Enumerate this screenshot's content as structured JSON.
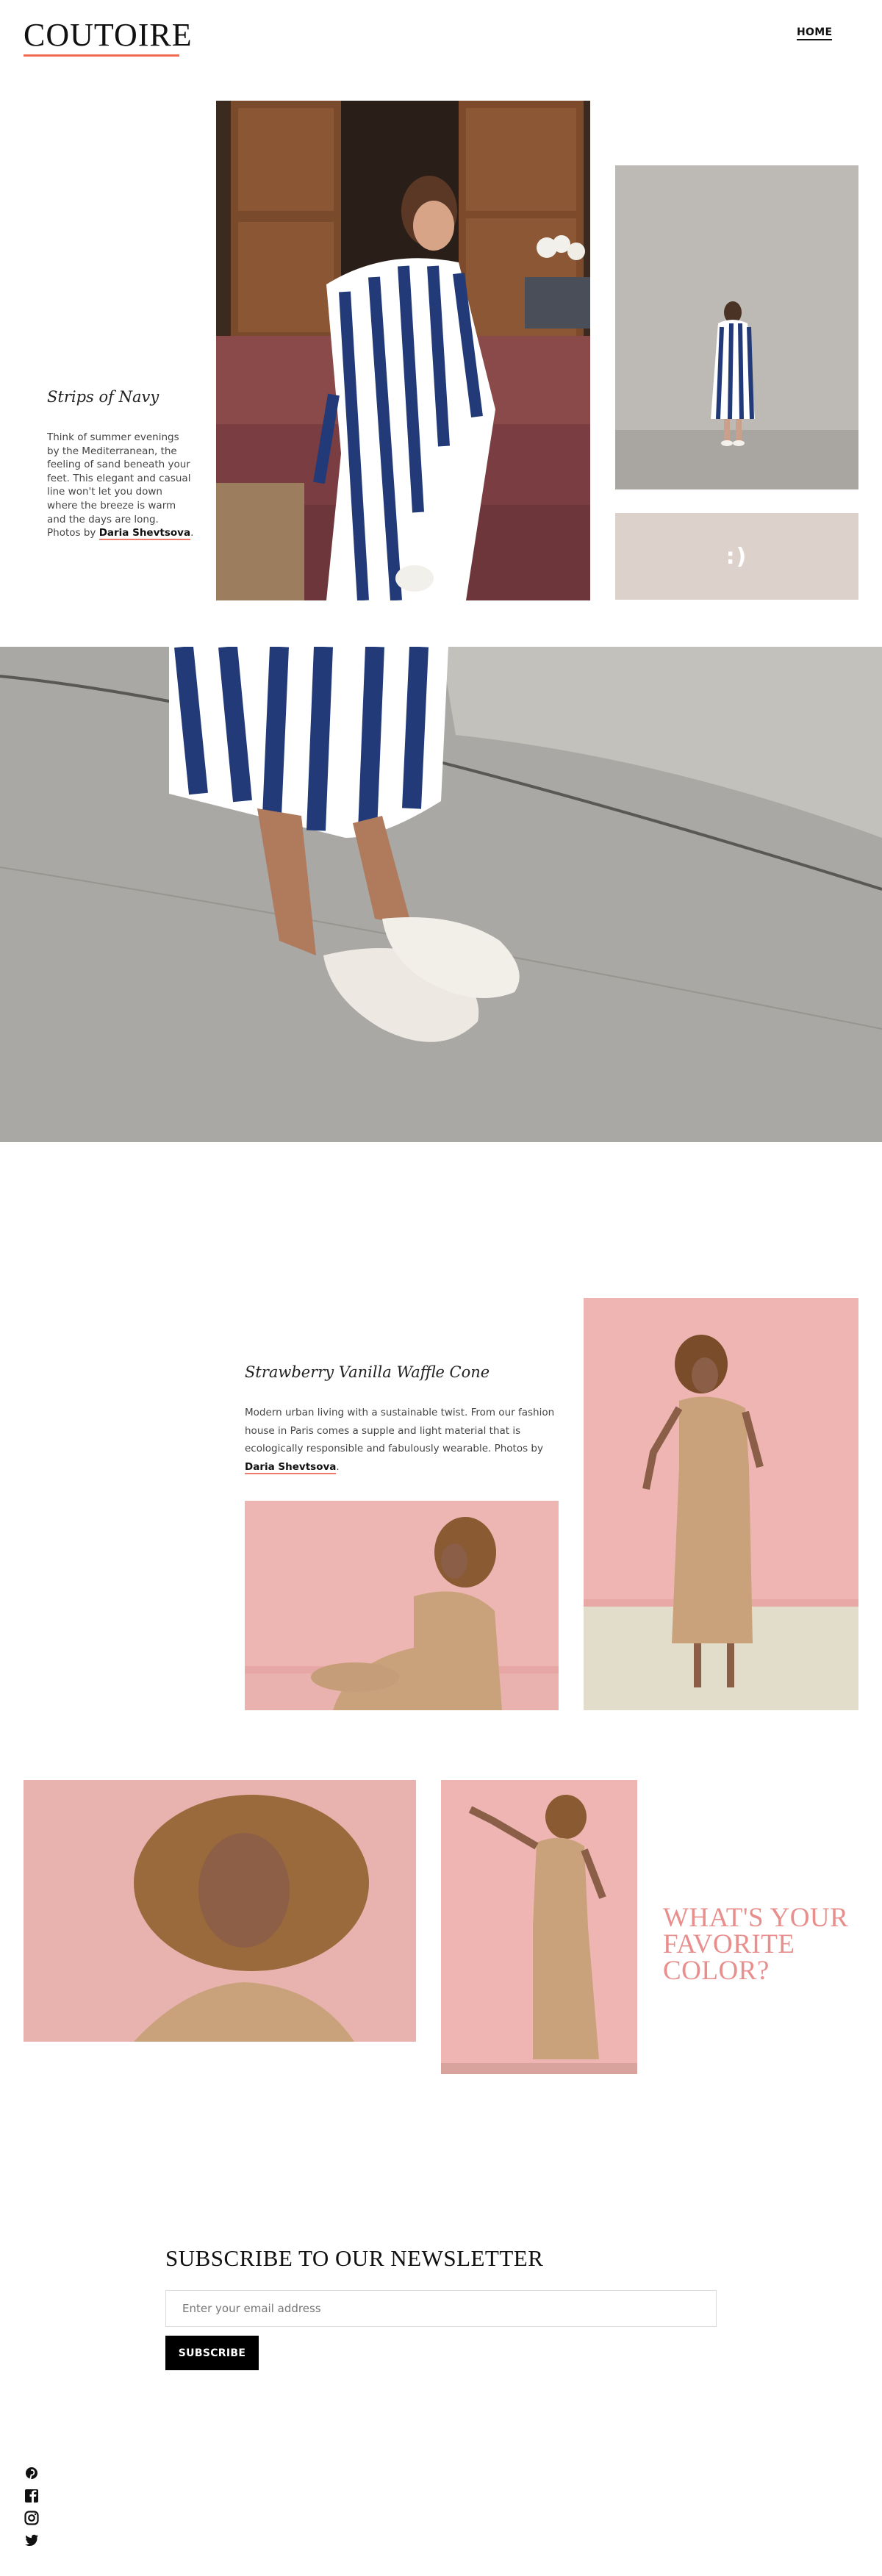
{
  "header": {
    "logo": "COUTOIRE",
    "nav": {
      "home": "HOME"
    }
  },
  "section1": {
    "title": "Strips of Navy",
    "text": "Think of summer evenings by the Mediterranean, the feeling of sand beneath your feet. This elegant and casual line won't let you down where the breeze is warm and the days are long. Photos by ",
    "credit": "Daria Shevtsova",
    "end": ".",
    "smile": ":)"
  },
  "section2": {
    "title": "Strawberry Vanilla Waffle Cone",
    "text": "Modern urban living with a sustainable twist. From our fashion house in Paris comes a supple and light material that is ecologically responsible and fabulously wearable. Photos by ",
    "credit": "Daria Shevtsova",
    "end": "."
  },
  "section3": {
    "question": "WHAT'S YOUR FAVORITE COLOR?"
  },
  "newsletter": {
    "title": "SUBSCRIBE TO OUR NEWSLETTER",
    "placeholder": "Enter your email address",
    "button": "SUBSCRIBE"
  },
  "social": [
    "pinterest-icon",
    "facebook-icon",
    "instagram-icon",
    "twitter-icon"
  ],
  "colors": {
    "accent": "#f26b50",
    "question": "#e88f8d",
    "smile_box": "#ddd2cb",
    "button": "#000000",
    "pink_wall": "#eeb5b3",
    "tan_dress": "#c9a27c",
    "navy": "#1f3573"
  }
}
